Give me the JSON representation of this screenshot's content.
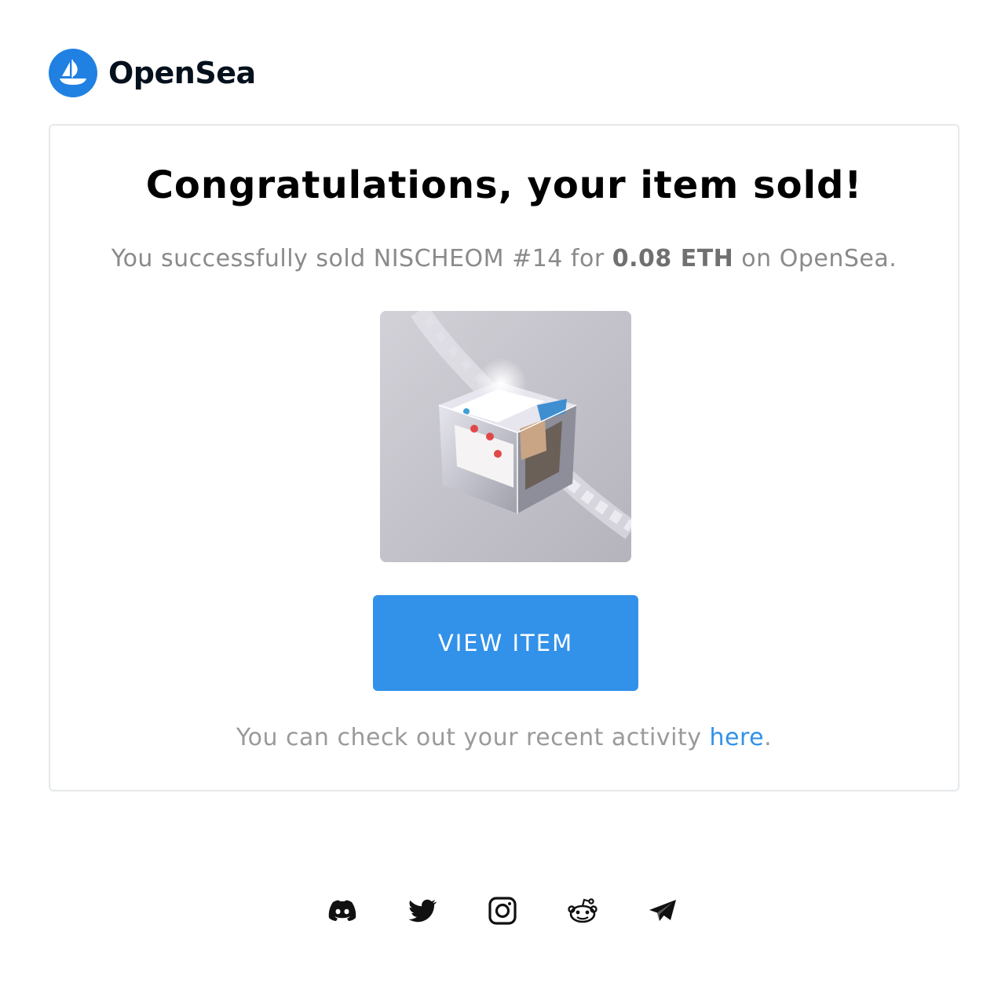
{
  "brand": {
    "name": "OpenSea",
    "logo_icon": "opensea-boat-icon",
    "accent": "#2081e2"
  },
  "card": {
    "headline": "Congratulations, your item sold!",
    "sold": {
      "prefix": "You successfully sold NISCHEOM #14 for ",
      "price": "0.08 ETH",
      "suffix": " on OpenSea."
    },
    "item_image": {
      "alt": "NISCHEOM #14"
    },
    "button_label": "VIEW ITEM",
    "button_color": "#3291e9",
    "activity": {
      "prefix": "You can check out your recent activity ",
      "link_text": "here",
      "suffix": "."
    }
  },
  "footer": {
    "socials": [
      {
        "name": "discord",
        "icon": "discord-icon"
      },
      {
        "name": "twitter",
        "icon": "twitter-icon"
      },
      {
        "name": "instagram",
        "icon": "instagram-icon"
      },
      {
        "name": "reddit",
        "icon": "reddit-icon"
      },
      {
        "name": "telegram",
        "icon": "telegram-icon"
      }
    ]
  }
}
